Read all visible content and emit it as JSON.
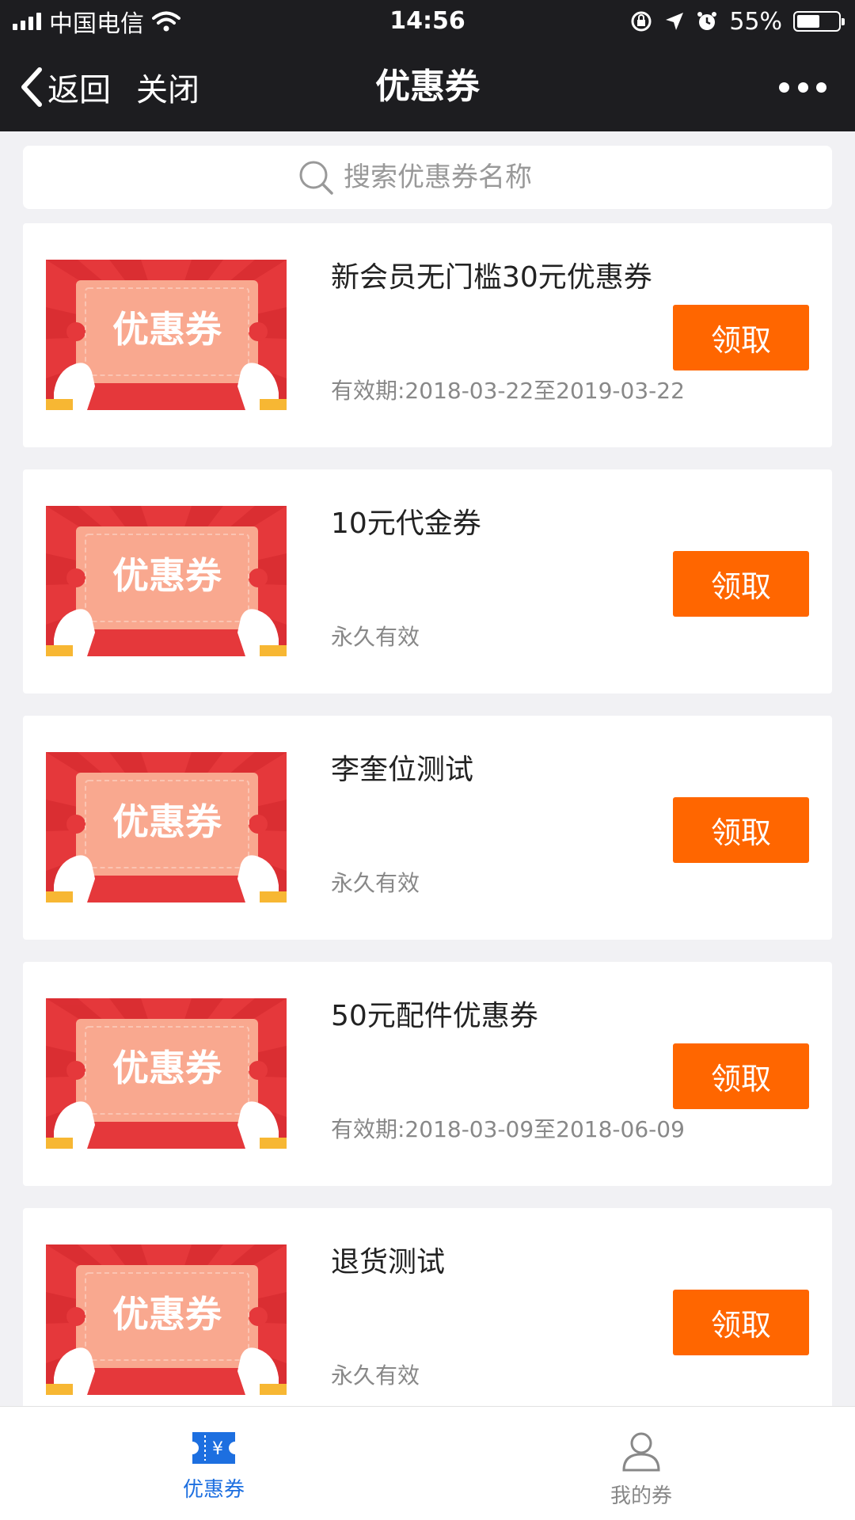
{
  "status_bar": {
    "carrier": "中国电信",
    "time": "14:56",
    "battery_text": "55%",
    "battery_level": 0.55
  },
  "nav": {
    "back_label": "返回",
    "close_label": "关闭",
    "title": "优惠券"
  },
  "search": {
    "placeholder": "搜索优惠券名称"
  },
  "coupons": [
    {
      "name": "新会员无门槛30元优惠券",
      "validity": "有效期:2018-03-22至2019-03-22",
      "button": "领取",
      "image_text": "优惠券"
    },
    {
      "name": "10元代金券",
      "validity": "永久有效",
      "button": "领取",
      "image_text": "优惠券"
    },
    {
      "name": "李奎位测试",
      "validity": "永久有效",
      "button": "领取",
      "image_text": "优惠券"
    },
    {
      "name": "50元配件优惠券",
      "validity": "有效期:2018-03-09至2018-06-09",
      "button": "领取",
      "image_text": "优惠券"
    },
    {
      "name": "退货测试",
      "validity": "永久有效",
      "button": "领取",
      "image_text": "优惠券"
    }
  ],
  "tabs": [
    {
      "label": "优惠券",
      "icon": "ticket-icon",
      "active": true
    },
    {
      "label": "我的券",
      "icon": "user-icon",
      "active": false
    }
  ],
  "colors": {
    "nav_bg": "#1d1d20",
    "accent_orange": "#ff6600",
    "active_tab_blue": "#1d6fe0",
    "coupon_red": "#e5383b"
  }
}
